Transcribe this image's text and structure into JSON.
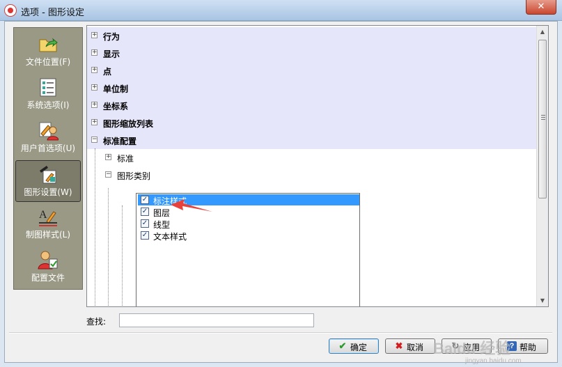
{
  "window": {
    "title": "选项 - 图形设定",
    "close_glyph": "✕"
  },
  "sidebar": {
    "items": [
      {
        "label": "文件位置(F)",
        "icon": "folder-arrow-icon"
      },
      {
        "label": "系统选项(I)",
        "icon": "checklist-icon"
      },
      {
        "label": "用户首选项(U)",
        "icon": "user-pencil-icon"
      },
      {
        "label": "图形设置(W)",
        "icon": "drawing-settings-icon",
        "active": true
      },
      {
        "label": "制图样式(L)",
        "icon": "text-style-icon"
      },
      {
        "label": "配置文件",
        "icon": "profile-user-icon"
      }
    ]
  },
  "tree": {
    "nodes": [
      {
        "label": "行为",
        "expander": "+"
      },
      {
        "label": "显示",
        "expander": "+"
      },
      {
        "label": "点",
        "expander": "+"
      },
      {
        "label": "单位制",
        "expander": "+"
      },
      {
        "label": "坐标系",
        "expander": "+"
      },
      {
        "label": "图形缩放列表",
        "expander": "+"
      },
      {
        "label": "标准配置",
        "expander": "−"
      }
    ],
    "children": [
      {
        "label": "标准",
        "expander": "+"
      },
      {
        "label": "图形类别",
        "expander": "−"
      }
    ],
    "checklist": [
      {
        "label": "标注样式",
        "checked": true,
        "selected": true
      },
      {
        "label": "图层",
        "checked": true
      },
      {
        "label": "线型",
        "checked": true
      },
      {
        "label": "文本样式",
        "checked": true
      }
    ]
  },
  "find": {
    "label": "查找:",
    "value": ""
  },
  "buttons": {
    "ok": "确定",
    "cancel": "取消",
    "apply": "应用",
    "help": "帮助"
  },
  "watermark": {
    "text": "Baidu 经验",
    "sub": "jingyan.baidu.com"
  },
  "colors": {
    "band": "#e6e6fa",
    "selected": "#3399ff",
    "sidebar": "#9a9986",
    "arrow": "#e8413c"
  }
}
